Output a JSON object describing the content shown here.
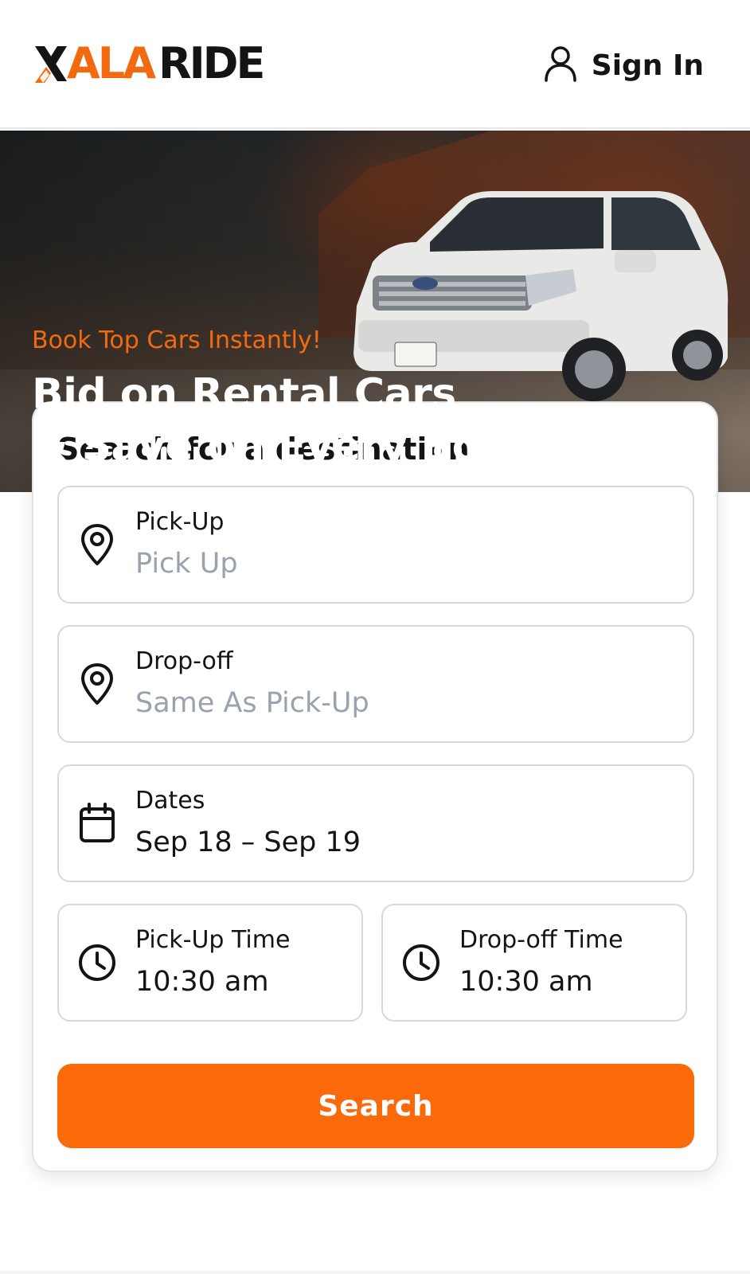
{
  "header": {
    "logo_accent": "ALA",
    "logo_dark": "RIDE",
    "signin_label": "Sign In"
  },
  "hero": {
    "tagline": "Book Top Cars Instantly!",
    "headline_line1": "Bid on Rental Cars",
    "headline_line2": "& Save on Every Booking"
  },
  "search": {
    "title": "Search for a destination",
    "pickup": {
      "label": "Pick-Up",
      "placeholder": "Pick Up"
    },
    "dropoff": {
      "label": "Drop-off",
      "placeholder": "Same As Pick-Up"
    },
    "dates": {
      "label": "Dates",
      "value": "Sep 18 – Sep 19"
    },
    "pickup_time": {
      "label": "Pick-Up Time",
      "value": "10:30 am"
    },
    "dropoff_time": {
      "label": "Drop-off Time",
      "value": "10:30 am"
    },
    "button_label": "Search"
  },
  "colors": {
    "accent": "#fb6a0a",
    "text": "#141414",
    "placeholder": "#9aa2ad",
    "border": "#d6d9de"
  },
  "icons": [
    "x-logo-icon",
    "user-icon",
    "location-pin-icon",
    "calendar-icon",
    "clock-icon"
  ]
}
